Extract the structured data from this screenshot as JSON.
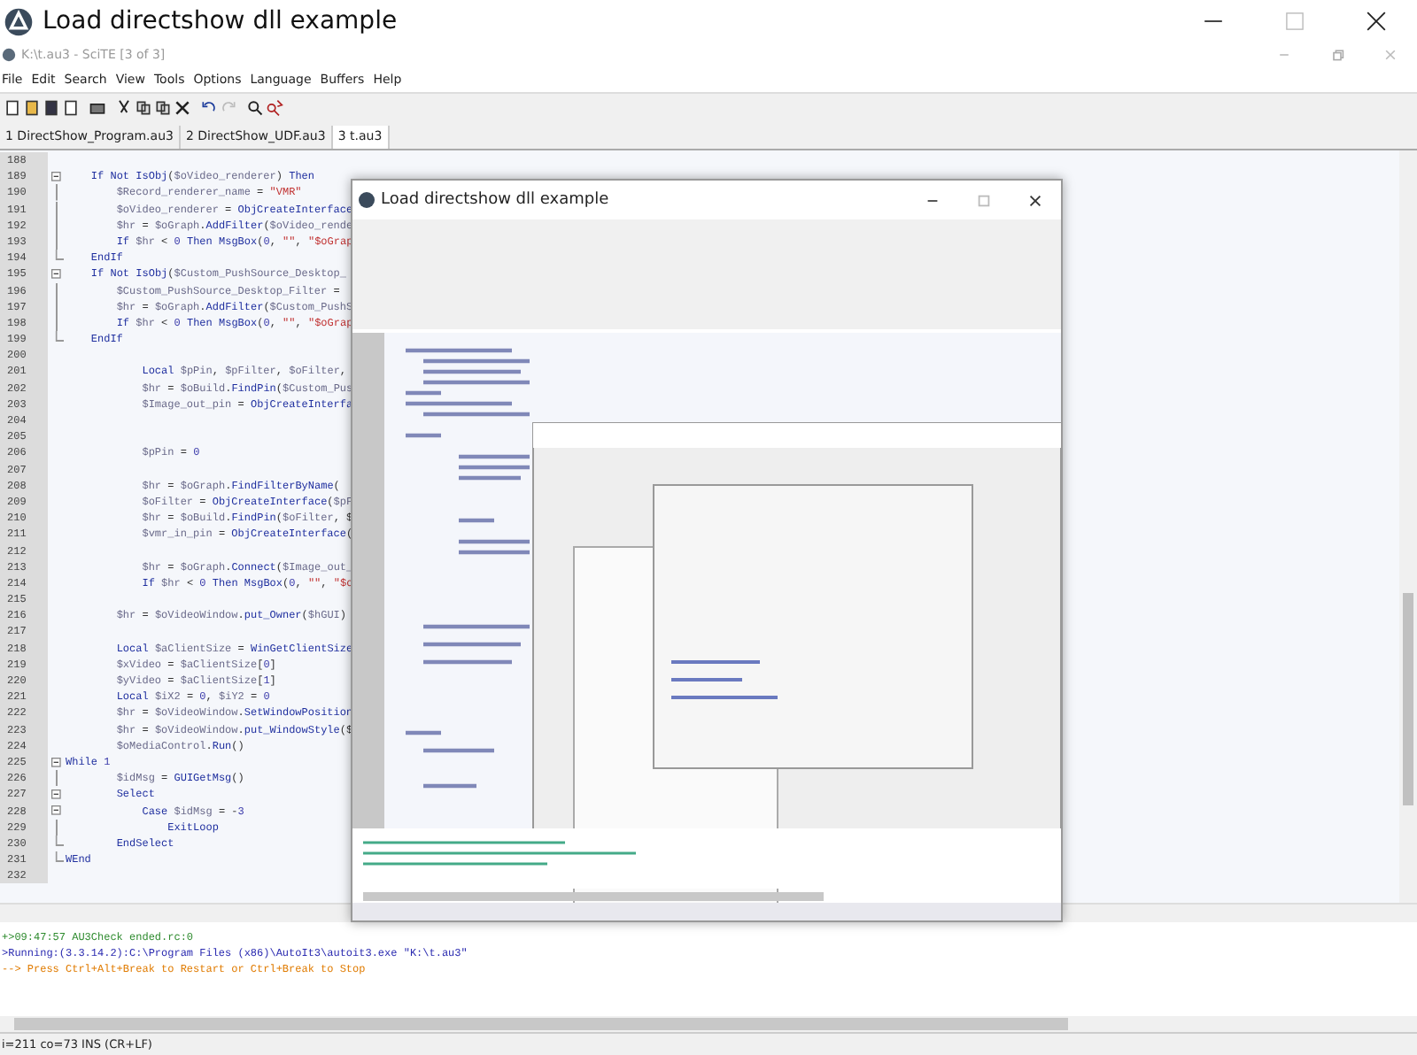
{
  "window": {
    "title": "Load directshow dll example"
  },
  "editor_window": {
    "title": "K:\\t.au3 - SciTE [3 of 3]"
  },
  "menu": [
    "File",
    "Edit",
    "Search",
    "View",
    "Tools",
    "Options",
    "Language",
    "Buffers",
    "Help"
  ],
  "tabs": [
    {
      "label": "1 DirectShow_Program.au3",
      "selected": false
    },
    {
      "label": "2 DirectShow_UDF.au3",
      "selected": false
    },
    {
      "label": "3 t.au3",
      "selected": true
    }
  ],
  "code_lines": [
    {
      "number": "188"
    },
    {
      "number": "189",
      "text": "    If Not IsObj($oVideo_renderer) Then",
      "kind": "open"
    },
    {
      "number": "190",
      "text": "        $Record_renderer_name = \"VMR\"",
      "kind": "inside"
    },
    {
      "number": "191",
      "text": "        $oVideo_renderer = ObjCreateInterface",
      "kind": "inside"
    },
    {
      "number": "192",
      "text": "        $hr = $oGraph.AddFilter($oVideo_rende",
      "kind": "inside"
    },
    {
      "number": "193",
      "text": "        If $hr < 0 Then MsgBox(0, \"\", \"$oGrap",
      "kind": "inside"
    },
    {
      "number": "194",
      "text": "    EndIf",
      "kind": "close"
    },
    {
      "number": "195",
      "text": "    If Not IsObj($Custom_PushSource_Desktop_",
      "kind": "open"
    },
    {
      "number": "196",
      "text": "        $Custom_PushSource_Desktop_Filter =",
      "kind": "inside"
    },
    {
      "number": "197",
      "text": "        $hr = $oGraph.AddFilter($Custom_PushS",
      "kind": "inside"
    },
    {
      "number": "198",
      "text": "        If $hr < 0 Then MsgBox(0, \"\", \"$oGrap",
      "kind": "inside"
    },
    {
      "number": "199",
      "text": "    EndIf",
      "kind": "close"
    },
    {
      "number": "200"
    },
    {
      "number": "201",
      "text": "            Local $pPin, $pFilter, $oFilter,"
    },
    {
      "number": "202",
      "text": "            $hr = $oBuild.FindPin($Custom_Pus"
    },
    {
      "number": "203",
      "text": "            $Image_out_pin = ObjCreateInterfa"
    },
    {
      "number": "204"
    },
    {
      "number": "205"
    },
    {
      "number": "206",
      "text": "            $pPin = 0"
    },
    {
      "number": "207"
    },
    {
      "number": "208",
      "text": "            $hr = $oGraph.FindFilterByName("
    },
    {
      "number": "209",
      "text": "            $oFilter = ObjCreateInterface($pF"
    },
    {
      "number": "210",
      "text": "            $hr = $oBuild.FindPin($oFilter, $"
    },
    {
      "number": "211",
      "text": "            $vmr_in_pin = ObjCreateInterface("
    },
    {
      "number": "212"
    },
    {
      "number": "213",
      "text": "            $hr = $oGraph.Connect($Image_out_"
    },
    {
      "number": "214",
      "text": "            If $hr < 0 Then MsgBox(0, \"\", \"$o"
    },
    {
      "number": "215"
    },
    {
      "number": "216",
      "text": "        $hr = $oVideoWindow.put_Owner($hGUI)"
    },
    {
      "number": "217"
    },
    {
      "number": "218",
      "text": "        Local $aClientSize = WinGetClientSize"
    },
    {
      "number": "219",
      "text": "        $xVideo = $aClientSize[0]"
    },
    {
      "number": "220",
      "text": "        $yVideo = $aClientSize[1]"
    },
    {
      "number": "221",
      "text": "        Local $iX2 = 0, $iY2 = 0"
    },
    {
      "number": "222",
      "text": "        $hr = $oVideoWindow.SetWindowPosition"
    },
    {
      "number": "223",
      "text": "        $hr = $oVideoWindow.put_WindowStyle($"
    },
    {
      "number": "224",
      "text": "        $oMediaControl.Run()"
    },
    {
      "number": "225",
      "text": "While 1",
      "kind": "open"
    },
    {
      "number": "226",
      "text": "        $idMsg = GUIGetMsg()",
      "kind": "inside"
    },
    {
      "number": "227",
      "text": "        Select",
      "kind": "open"
    },
    {
      "number": "228",
      "text": "            Case $idMsg = -3",
      "kind": "open"
    },
    {
      "number": "229",
      "text": "                ExitLoop",
      "kind": "inside"
    },
    {
      "number": "230",
      "text": "        EndSelect",
      "kind": "close"
    },
    {
      "number": "231",
      "text": "WEnd",
      "kind": "close"
    },
    {
      "number": "232"
    }
  ],
  "output": [
    {
      "text": "+>09:47:57 AU3Check ended.rc:0",
      "color": "#2e8b2e"
    },
    {
      "text": ">Running:(3.3.14.2):C:\\Program Files (x86)\\AutoIt3\\autoit3.exe \"K:\\t.au3\"",
      "color": "#2a2ab0"
    },
    {
      "text": "--> Press Ctrl+Alt+Break to Restart or Ctrl+Break to Stop",
      "color": "#e07b00"
    }
  ],
  "status_bar": "i=211 co=73 INS (CR+LF)",
  "overlay_window": {
    "title": "Load directshow dll example"
  }
}
